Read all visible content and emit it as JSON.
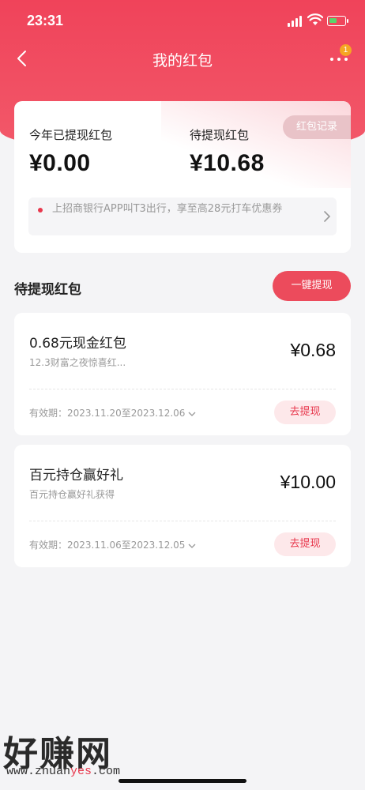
{
  "status_bar": {
    "time": "23:31"
  },
  "nav": {
    "title": "我的红包",
    "badge_count": "1"
  },
  "summary": {
    "withdrawn_label": "今年已提现红包",
    "withdrawn_amount": "¥0.00",
    "pending_label": "待提现红包",
    "pending_amount": "¥10.68",
    "record_button": "红包记录",
    "notice_text": "上招商银行APP叫T3出行，享至高28元打车优惠券"
  },
  "section": {
    "title": "待提现红包",
    "withdraw_all_button": "一键提现"
  },
  "packets": [
    {
      "title": "0.68元现金红包",
      "desc": "12.3财富之夜惊喜红...",
      "amount": "¥0.68",
      "validity": "有效期：2023.11.20至2023.12.06",
      "button": "去提现"
    },
    {
      "title": "百元持仓赢好礼",
      "desc": "百元持仓赢好礼获得",
      "amount": "¥10.00",
      "validity": "有效期：2023.11.06至2023.12.05",
      "button": "去提现"
    }
  ],
  "watermark": {
    "main": "好赚网",
    "url_prefix": "www.zhuan",
    "url_accent": "yes",
    "url_suffix": ".com"
  },
  "colors": {
    "brand_red": "#f0435a",
    "button_red": "#ec4b5c",
    "light_pink": "#fde8ea",
    "badge_orange": "#f5a623"
  },
  "icons": [
    "back-icon",
    "more-icon",
    "signal-icon",
    "wifi-icon",
    "battery-icon",
    "chevron-right-icon",
    "chevron-down-icon"
  ]
}
